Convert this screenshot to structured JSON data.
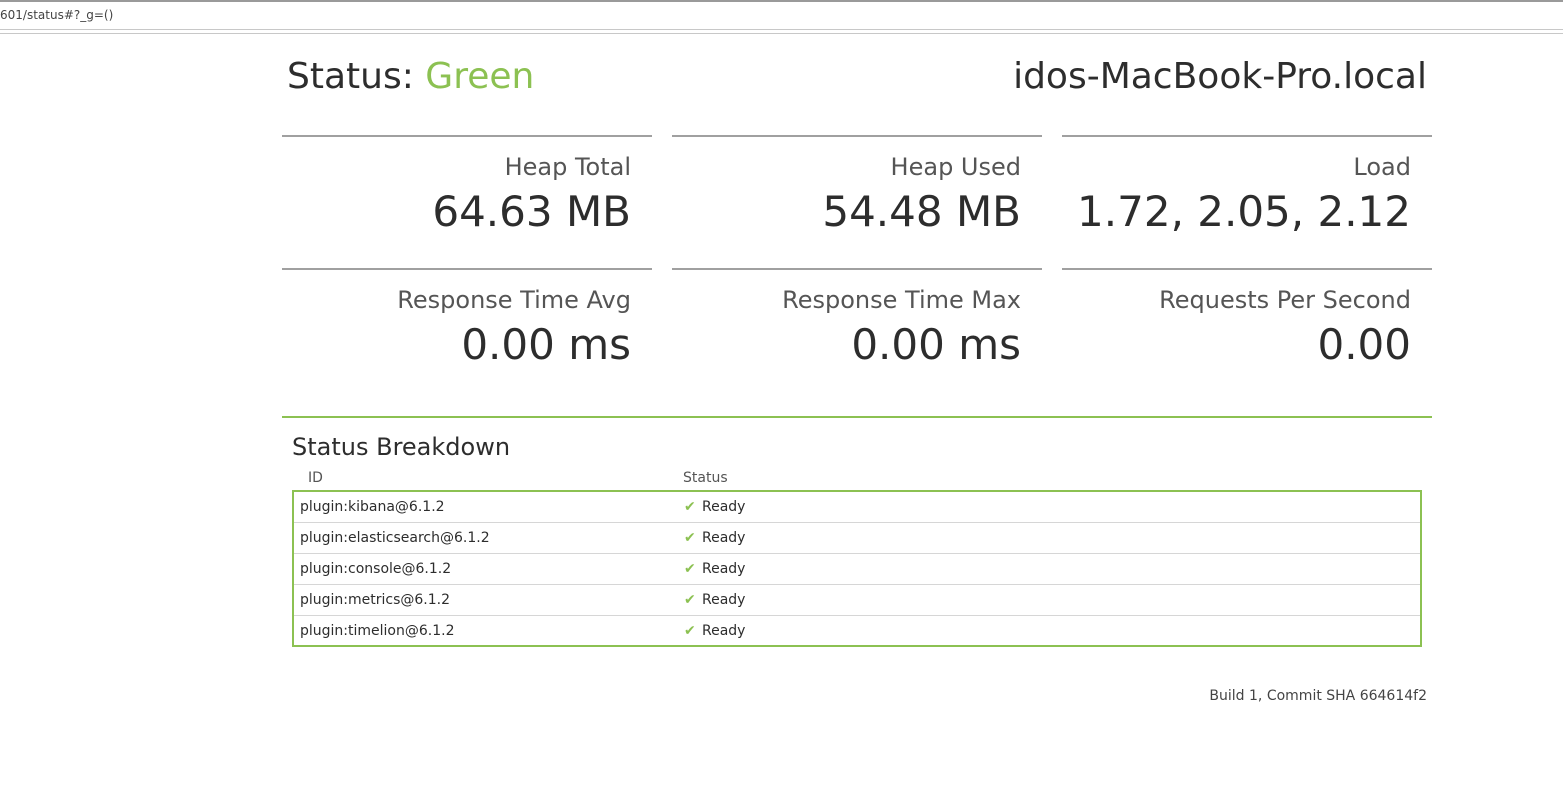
{
  "browser": {
    "url": "601/status#?_g=()"
  },
  "header": {
    "status_label": "Status: ",
    "status_value": "Green",
    "hostname": "idos-MacBook-Pro.local"
  },
  "colors": {
    "accent_green": "#8cc152",
    "divider_gray": "#a0a0a0"
  },
  "metrics": [
    {
      "title": "Heap Total",
      "value": "64.63 MB"
    },
    {
      "title": "Heap Used",
      "value": "54.48 MB"
    },
    {
      "title": "Load",
      "value": "1.72, 2.05, 2.12"
    },
    {
      "title": "Response Time Avg",
      "value": "0.00 ms"
    },
    {
      "title": "Response Time Max",
      "value": "0.00 ms"
    },
    {
      "title": "Requests Per Second",
      "value": "0.00"
    }
  ],
  "breakdown": {
    "title": "Status Breakdown",
    "columns": [
      "ID",
      "Status"
    ],
    "rows": [
      {
        "id": "plugin:kibana@6.1.2",
        "status": "Ready",
        "icon": "check-icon"
      },
      {
        "id": "plugin:elasticsearch@6.1.2",
        "status": "Ready",
        "icon": "check-icon"
      },
      {
        "id": "plugin:console@6.1.2",
        "status": "Ready",
        "icon": "check-icon"
      },
      {
        "id": "plugin:metrics@6.1.2",
        "status": "Ready",
        "icon": "check-icon"
      },
      {
        "id": "plugin:timelion@6.1.2",
        "status": "Ready",
        "icon": "check-icon"
      }
    ]
  },
  "footer": {
    "build": "Build 1, Commit SHA 664614f2"
  }
}
